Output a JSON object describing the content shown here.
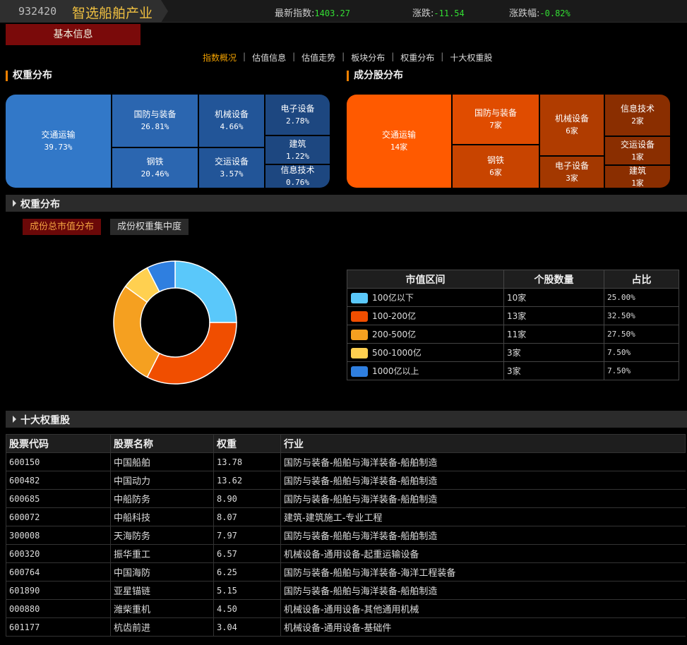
{
  "header": {
    "code": "932420",
    "name": "智选船舶产业",
    "latest_label": "最新指数:",
    "latest_value": "1403.27",
    "change_label": "涨跌:",
    "change_value": "-11.54",
    "pct_label": "涨跌幅:",
    "pct_value": "-0.82%"
  },
  "basic_info_button": "基本信息",
  "nav": [
    "指数概况",
    "估值信息",
    "估值走势",
    "板块分布",
    "权重分布",
    "十大权重股"
  ],
  "weight_section_title": "权重分布",
  "component_section_title": "成分股分布",
  "weight_treemap": [
    {
      "name": "交通运输",
      "value": "39.73%"
    },
    {
      "name": "国防与装备",
      "value": "26.81%"
    },
    {
      "name": "钢铁",
      "value": "20.46%"
    },
    {
      "name": "机械设备",
      "value": "4.66%"
    },
    {
      "name": "交运设备",
      "value": "3.57%"
    },
    {
      "name": "电子设备",
      "value": "2.78%"
    },
    {
      "name": "建筑",
      "value": "1.22%"
    },
    {
      "name": "信息技术",
      "value": "0.76%"
    }
  ],
  "component_treemap": [
    {
      "name": "交通运输",
      "value": "14家"
    },
    {
      "name": "国防与装备",
      "value": "7家"
    },
    {
      "name": "钢铁",
      "value": "6家"
    },
    {
      "name": "机械设备",
      "value": "6家"
    },
    {
      "name": "电子设备",
      "value": "3家"
    },
    {
      "name": "信息技术",
      "value": "2家"
    },
    {
      "name": "交运设备",
      "value": "1家"
    },
    {
      "name": "建筑",
      "value": "1家"
    }
  ],
  "weight_bar_title": "权重分布",
  "tabs": [
    "成份总市值分布",
    "成份权重集中度"
  ],
  "chart_data": {
    "type": "pie",
    "donut": true,
    "categories": [
      "100亿以下",
      "100-200亿",
      "200-500亿",
      "500-1000亿",
      "1000亿以上"
    ],
    "values": [
      25.0,
      32.5,
      27.5,
      7.5,
      7.5
    ],
    "counts": [
      10,
      13,
      11,
      3,
      3
    ],
    "colors": [
      "#5ac8fa",
      "#f04e00",
      "#f5a020",
      "#ffd050",
      "#2f7fe0"
    ]
  },
  "legend_table": {
    "headers": [
      "市值区间",
      "个股数量",
      "占比"
    ],
    "rows": [
      {
        "range": "100亿以下",
        "count": "10家",
        "pct": "25.00%"
      },
      {
        "range": "100-200亿",
        "count": "13家",
        "pct": "32.50%"
      },
      {
        "range": "200-500亿",
        "count": "11家",
        "pct": "27.50%"
      },
      {
        "range": "500-1000亿",
        "count": "3家",
        "pct": "7.50%"
      },
      {
        "range": "1000亿以上",
        "count": "3家",
        "pct": "7.50%"
      }
    ]
  },
  "top10_bar_title": "十大权重股",
  "top10": {
    "headers": [
      "股票代码",
      "股票名称",
      "权重",
      "行业"
    ],
    "rows": [
      {
        "code": "600150",
        "name": "中国船舶",
        "weight": "13.78",
        "industry": "国防与装备-船舶与海洋装备-船舶制造"
      },
      {
        "code": "600482",
        "name": "中国动力",
        "weight": "13.62",
        "industry": "国防与装备-船舶与海洋装备-船舶制造"
      },
      {
        "code": "600685",
        "name": "中船防务",
        "weight": "8.90",
        "industry": "国防与装备-船舶与海洋装备-船舶制造"
      },
      {
        "code": "600072",
        "name": "中船科技",
        "weight": "8.07",
        "industry": "建筑-建筑施工-专业工程"
      },
      {
        "code": "300008",
        "name": "天海防务",
        "weight": "7.97",
        "industry": "国防与装备-船舶与海洋装备-船舶制造"
      },
      {
        "code": "600320",
        "name": "振华重工",
        "weight": "6.57",
        "industry": "机械设备-通用设备-起重运输设备"
      },
      {
        "code": "600764",
        "name": "中国海防",
        "weight": "6.25",
        "industry": "国防与装备-船舶与海洋装备-海洋工程装备"
      },
      {
        "code": "601890",
        "name": "亚星锚链",
        "weight": "5.15",
        "industry": "国防与装备-船舶与海洋装备-船舶制造"
      },
      {
        "code": "000880",
        "name": "潍柴重机",
        "weight": "4.50",
        "industry": "机械设备-通用设备-其他通用机械"
      },
      {
        "code": "601177",
        "name": "杭齿前进",
        "weight": "3.04",
        "industry": "机械设备-通用设备-基础件"
      }
    ]
  }
}
